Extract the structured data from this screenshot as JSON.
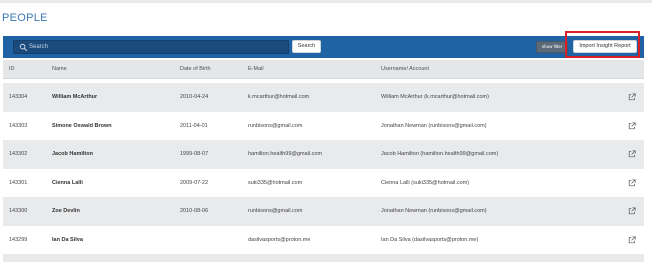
{
  "page": {
    "title": "PEOPLE"
  },
  "toolbar": {
    "search_placeholder": "Search",
    "search_button": "Search",
    "filter_button": "show filter",
    "import_button": "Import Insight Report"
  },
  "table": {
    "headers": [
      "ID",
      "Name",
      "Date of Birth",
      "E-Mail",
      "Username/ Account"
    ],
    "rows": [
      {
        "id": "143304",
        "name": "William McArthur",
        "dob": "2010-04-24",
        "email": "k.mcarthur@hotmail.com",
        "username": "William McArthur (k.mcarthur@hotmail.com)"
      },
      {
        "id": "143303",
        "name": "Simone Oswald Brown",
        "dob": "2011-04-01",
        "email": "runbisons@gmail.com",
        "username": "Jonathan Newman (runbisons@gmail.com)"
      },
      {
        "id": "143302",
        "name": "Jacob Hamilton",
        "dob": "1999-08-07",
        "email": "hamilton.health99@gmail.com",
        "username": "Jacob Hamilton (hamilton.health99@gmail.com)"
      },
      {
        "id": "143301",
        "name": "Cienna Lalli",
        "dob": "2009-07-22",
        "email": "suki335@hotmail.com",
        "username": "Cienna Lalli (suki335@hotmail.com)"
      },
      {
        "id": "143300",
        "name": "Zoe Devlin",
        "dob": "2010-08-06",
        "email": "runbisons@gmail.com",
        "username": "Jonathan Newman (runbisons@gmail.com)"
      },
      {
        "id": "143299",
        "name": "Ian Da Silva",
        "dob": "",
        "email": "dasilvasports@proton.me",
        "username": "Ian Da Silva (dasilvasports@proton.me)"
      }
    ]
  },
  "icons": {
    "search": "search-icon",
    "row_action": "external-link-icon"
  },
  "colors": {
    "title": "#3a78b5",
    "toolbar": "#1f63a4",
    "highlight": "#d61f26",
    "row_alt": "#e9eaec"
  }
}
